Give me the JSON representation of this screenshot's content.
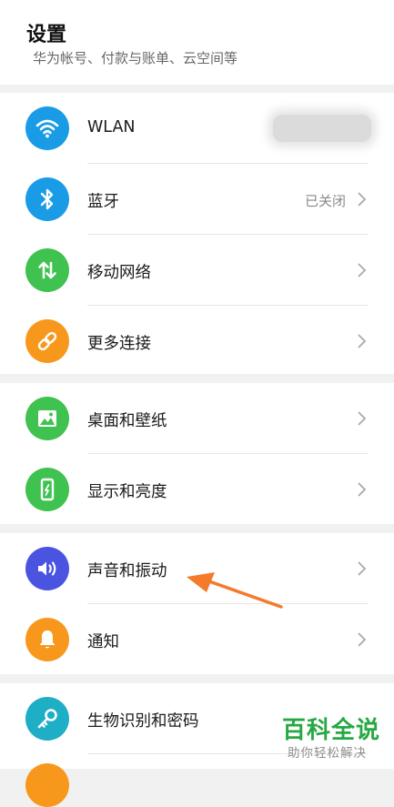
{
  "header": {
    "title": "设置",
    "hint": "华为帐号、付款与账单、云空间等"
  },
  "groups": [
    {
      "items": [
        {
          "label": "WLAN",
          "icon": "wifi-icon",
          "color": "#1a9be6"
        },
        {
          "label": "蓝牙",
          "icon": "bluetooth-icon",
          "color": "#1a9be6",
          "status": "已关闭"
        },
        {
          "label": "移动网络",
          "icon": "mobile-data-icon",
          "color": "#3fc24f"
        },
        {
          "label": "更多连接",
          "icon": "link-icon",
          "color": "#f7981d"
        }
      ]
    },
    {
      "items": [
        {
          "label": "桌面和壁纸",
          "icon": "wallpaper-icon",
          "color": "#3fc24f"
        },
        {
          "label": "显示和亮度",
          "icon": "display-icon",
          "color": "#3fc24f"
        }
      ]
    },
    {
      "items": [
        {
          "label": "声音和振动",
          "icon": "speaker-icon",
          "color": "#4a54e1"
        },
        {
          "label": "通知",
          "icon": "bell-icon",
          "color": "#f7981d"
        }
      ]
    },
    {
      "items": [
        {
          "label": "生物识别和密码",
          "icon": "key-icon",
          "color": "#1eaec6"
        }
      ]
    }
  ],
  "watermark": {
    "title": "百科全说",
    "subtitle": "助你轻松解决"
  },
  "annotation": {
    "color": "#f47a2c"
  }
}
